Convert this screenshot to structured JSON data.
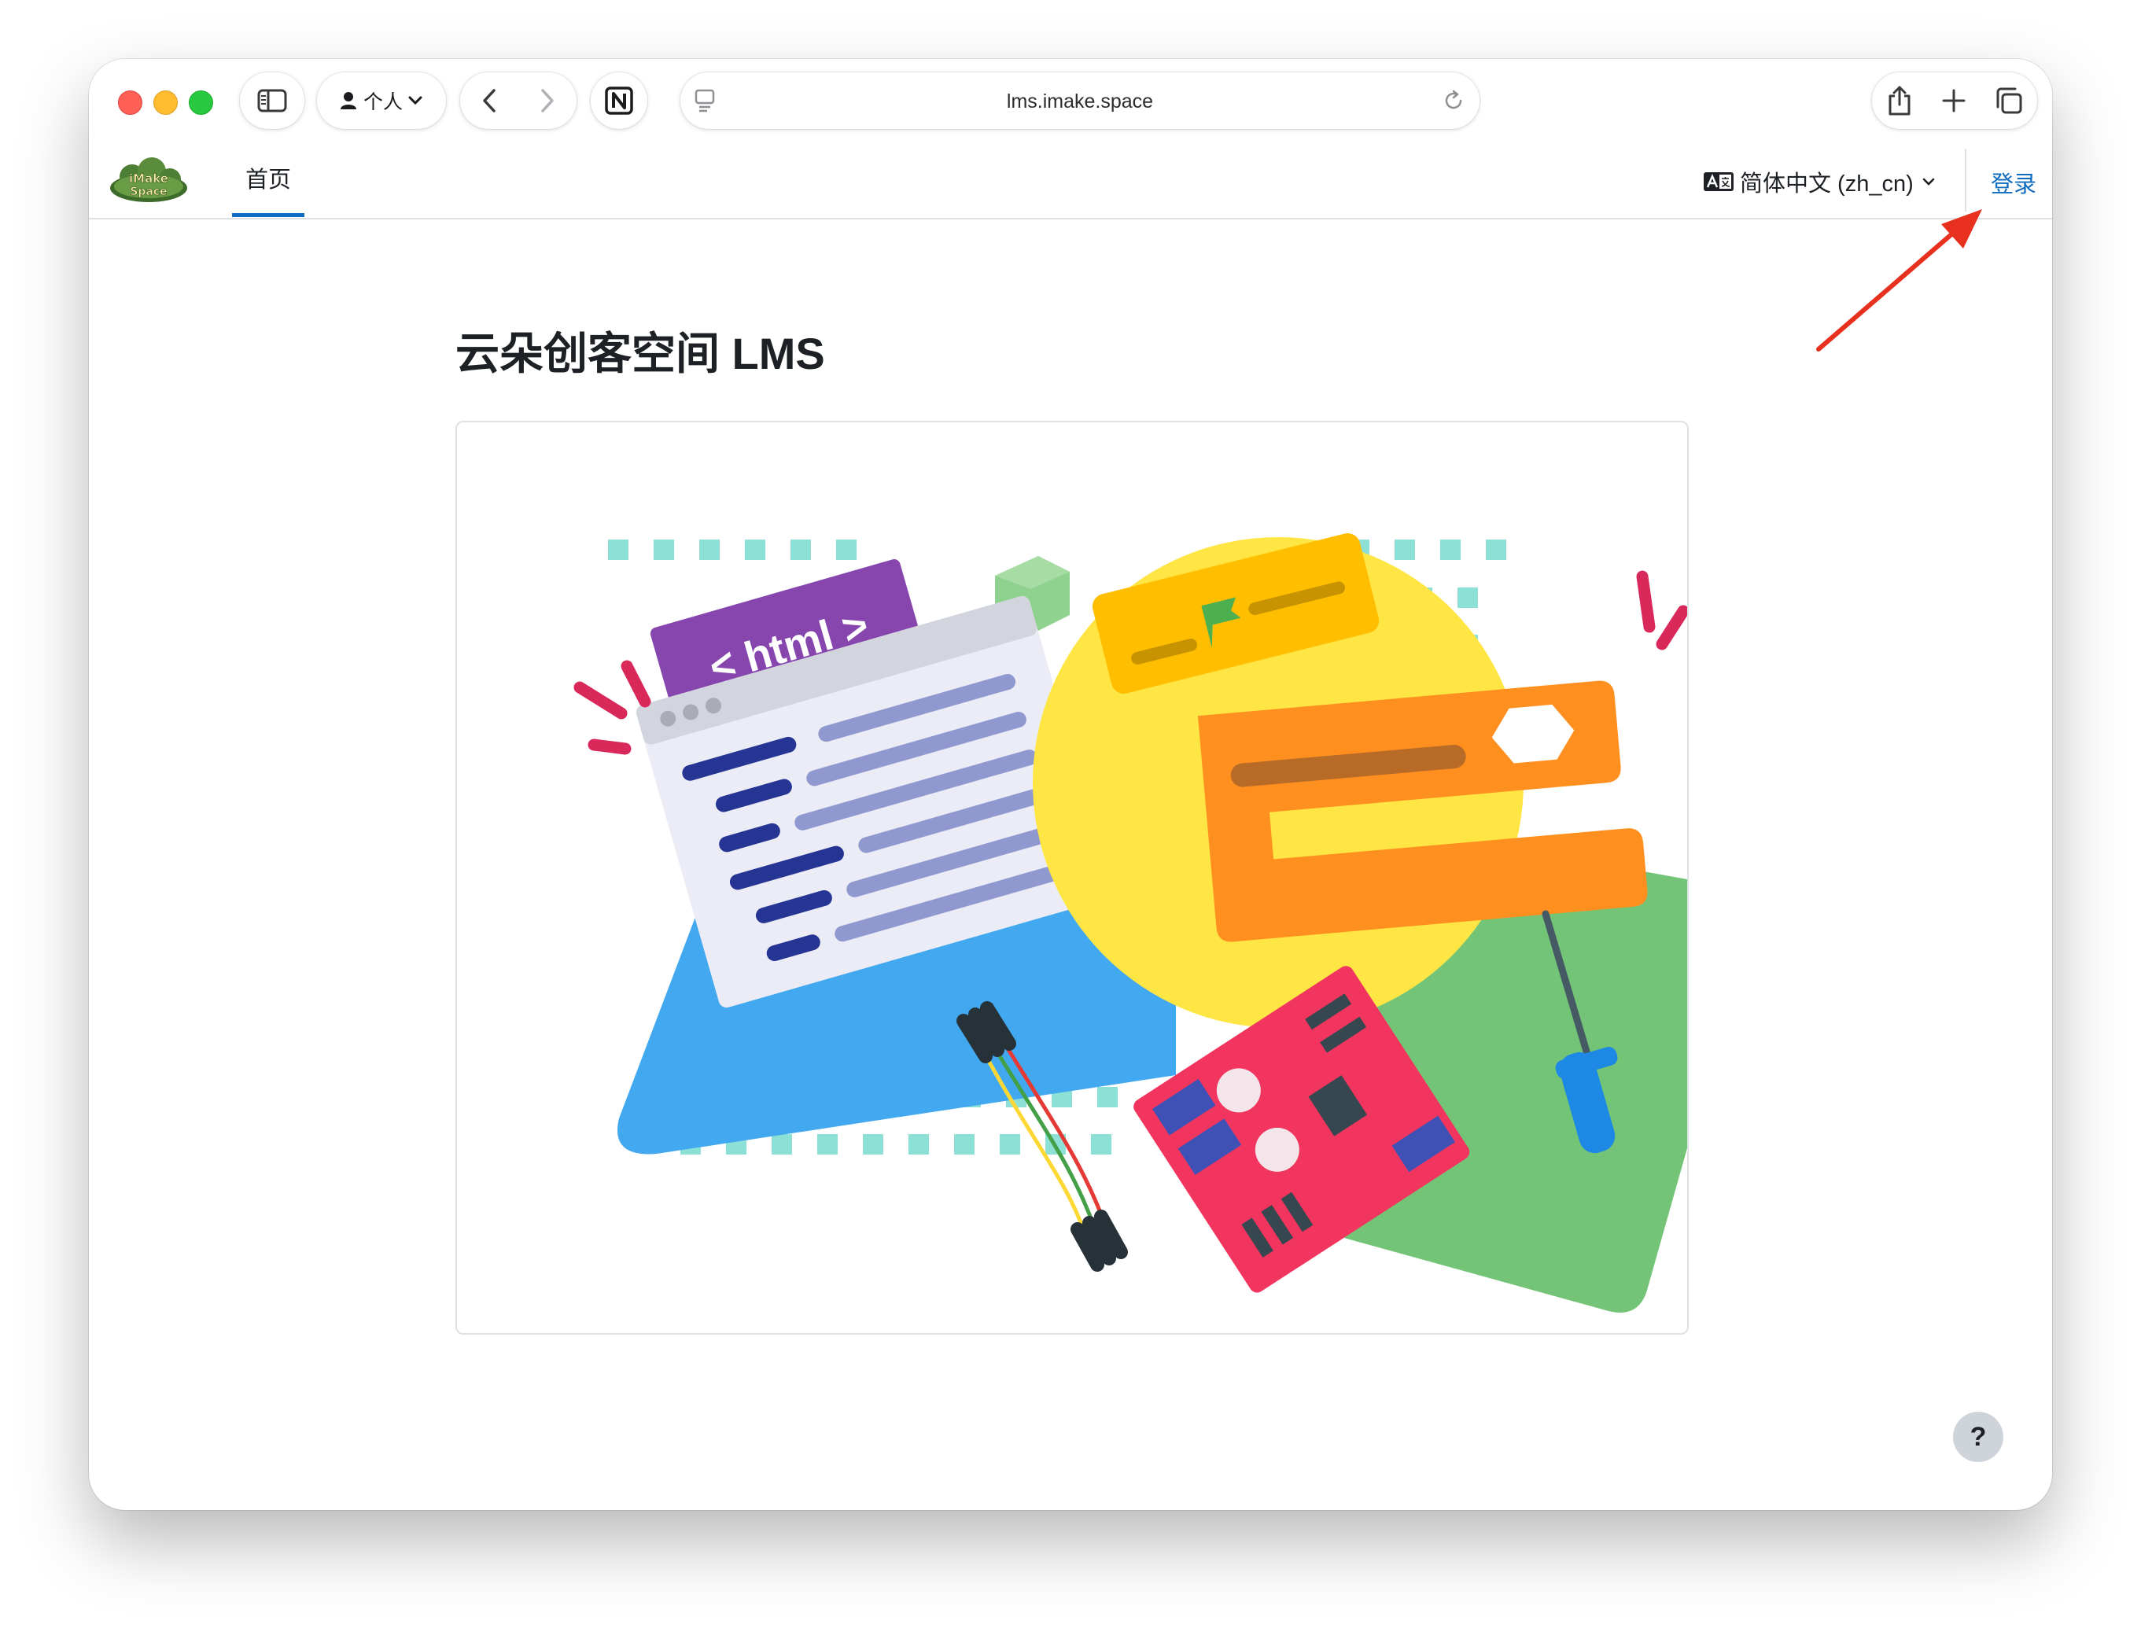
{
  "browser": {
    "profile_label": "个人",
    "url": "lms.imake.space"
  },
  "site": {
    "logo_text_top": "iMake",
    "logo_text_bottom": "Space",
    "nav_home": "首页",
    "language": "简体中文 (zh_cn)",
    "login": "登录"
  },
  "main": {
    "title": "云朵创客空间 LMS",
    "hero_code_label": "< html >"
  },
  "help": {
    "label": "?"
  },
  "colors": {
    "accent": "#0f6cbf",
    "annotation": "#e8301f",
    "hero_blue": "#42a9f0",
    "hero_green": "#74c477",
    "hero_yellow": "#ffe645",
    "hero_orange": "#ff9020",
    "hero_purple": "#8646ae",
    "hero_teal": "#8de0d6",
    "hero_pcb": "#f2355e"
  }
}
